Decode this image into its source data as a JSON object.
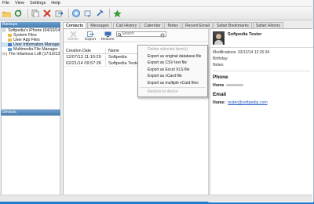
{
  "menu": [
    "File",
    "View",
    "Settings",
    "Help"
  ],
  "toolbar_icons": [
    "open-folder-icon",
    "refresh-icon",
    "copy-icon",
    "delete-icon",
    "export-icon",
    "device-icon",
    "restore-icon",
    "tools-icon",
    "star-icon"
  ],
  "backups": {
    "header": "Backups",
    "items": [
      {
        "label": "Softpedia's iPhone (04/10/14",
        "icon": "phone-icon",
        "level": 0,
        "selected": false
      },
      {
        "label": "System Files",
        "icon": "folder-icon",
        "level": 1,
        "selected": false
      },
      {
        "label": "User App Files",
        "icon": "folder-icon",
        "level": 1,
        "selected": false
      },
      {
        "label": "User Information Manage",
        "icon": "contacts-icon",
        "level": 1,
        "selected": true
      },
      {
        "label": "Multimedia File Manager",
        "icon": "media-icon",
        "level": 1,
        "selected": false
      },
      {
        "label": "The Infamous Loft (17/10/13",
        "icon": "phone-icon",
        "level": 0,
        "selected": false
      }
    ]
  },
  "devices": {
    "header": "Devices"
  },
  "tabs": [
    "Contacts",
    "Messages",
    "Call History",
    "Calendar",
    "Notes",
    "Recent Email",
    "Safari Bookmarks",
    "Safari History"
  ],
  "active_tab": "Contacts",
  "content_toolbar": {
    "delete": "Delete",
    "export": "Export",
    "restore": "Restore"
  },
  "search": {
    "placeholder": "Search"
  },
  "contacts": {
    "columns": [
      "Creation Date",
      "Name"
    ],
    "rows": [
      {
        "date": "12/07/13 11:10:29",
        "name": "Softpedia"
      },
      {
        "date": "02/21/14 09:57:26",
        "name": "Softpedia Tester"
      }
    ]
  },
  "context_menu": [
    {
      "label": "Delete selected item(s)",
      "disabled": true
    },
    {
      "label": "Export as original database file",
      "disabled": false
    },
    {
      "label": "Export as CSV text file",
      "disabled": false
    },
    {
      "label": "Export as Excel XLS file",
      "disabled": false
    },
    {
      "label": "Export as vCard file",
      "disabled": false
    },
    {
      "label": "Export as multiple vCard files",
      "disabled": false
    },
    {
      "sep": true
    },
    {
      "label": "Restore to device",
      "disabled": true
    }
  ],
  "detail": {
    "name": "Softpedia Tester",
    "modifications_label": "Modifications:",
    "modifications": "03/12/14 12:26:34",
    "birthday_label": "Birthday:",
    "notes_label": "Notes:",
    "phone_section": "Phone",
    "phone_label": "Home",
    "email_section": "Email",
    "email_label": "Home:",
    "email": "tester@softpedia.com"
  },
  "colors": {
    "accent": "#1e7bd0",
    "link": "#1f56c7",
    "selection": "#cfe3f7"
  }
}
